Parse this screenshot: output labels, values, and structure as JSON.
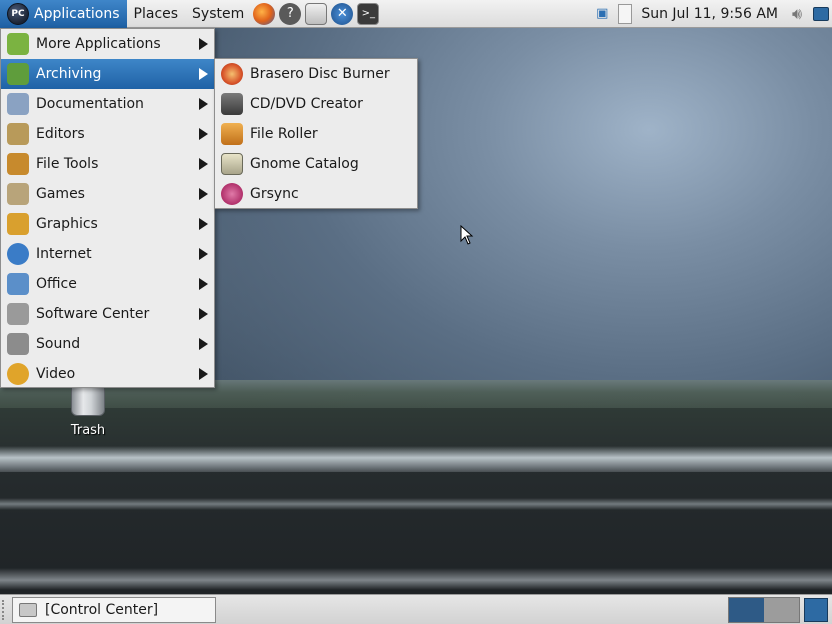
{
  "top_panel": {
    "menus": [
      "Applications",
      "Places",
      "System"
    ],
    "logo_text": "PC",
    "launchers": [
      "firefox-icon",
      "help-icon",
      "file-manager-icon",
      "control-center-icon",
      "terminal-icon"
    ],
    "clock": "Sun Jul 11,  9:56 AM"
  },
  "applications_menu": {
    "items": [
      {
        "label": "More Applications",
        "icon": "more-applications-icon",
        "color": "#7bb341"
      },
      {
        "label": "Archiving",
        "icon": "archive-icon",
        "color": "#5f9d3c"
      },
      {
        "label": "Documentation",
        "icon": "book-icon",
        "color": "#8aa2c2"
      },
      {
        "label": "Editors",
        "icon": "notepad-icon",
        "color": "#b89a5a"
      },
      {
        "label": "File Tools",
        "icon": "file-cabinet-icon",
        "color": "#c78a2d"
      },
      {
        "label": "Games",
        "icon": "joystick-icon",
        "color": "#b8a47a"
      },
      {
        "label": "Graphics",
        "icon": "palette-icon",
        "color": "#d9a02e"
      },
      {
        "label": "Internet",
        "icon": "globe-icon",
        "color": "#3a7cc7"
      },
      {
        "label": "Office",
        "icon": "office-icon",
        "color": "#5b8fc9"
      },
      {
        "label": "Software Center",
        "icon": "software-center-icon",
        "color": "#9a9a9a"
      },
      {
        "label": "Sound",
        "icon": "speaker-icon",
        "color": "#8c8c8c"
      },
      {
        "label": "Video",
        "icon": "video-icon",
        "color": "#e0a42a"
      }
    ],
    "selected": "Archiving"
  },
  "archiving_submenu": {
    "items": [
      {
        "label": "Brasero Disc Burner",
        "icon": "disc-burner-icon",
        "color": "#d8542a"
      },
      {
        "label": "CD/DVD Creator",
        "icon": "cd-dvd-creator-icon",
        "color": "#555555"
      },
      {
        "label": "File Roller",
        "icon": "file-roller-icon",
        "color": "#d08a2a"
      },
      {
        "label": "Gnome Catalog",
        "icon": "catalog-icon",
        "color": "#8a8a6a"
      },
      {
        "label": "Grsync",
        "icon": "sync-icon",
        "color": "#b0306a"
      }
    ]
  },
  "desktop": {
    "trash_label": "Trash"
  },
  "bottom_panel": {
    "task_label": "[Control Center]"
  }
}
